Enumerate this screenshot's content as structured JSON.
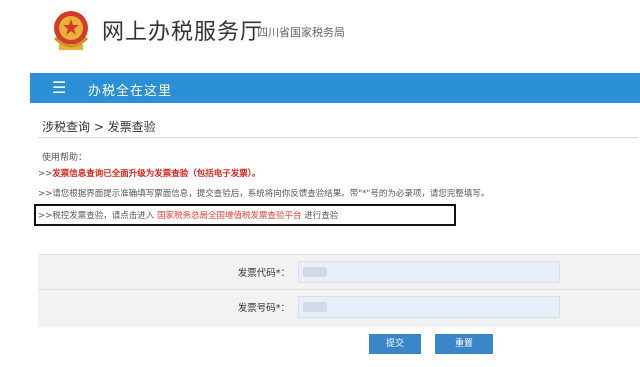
{
  "header": {
    "emblem_icon": "national-emblem-icon",
    "title": "网上办税服务厅",
    "subtitle": "四川省国家税务局"
  },
  "navbar": {
    "menu_icon": "☰",
    "label": "办税全在这里",
    "color": "#2a8fd5"
  },
  "breadcrumb": "涉税查询 > 发票查验",
  "help": {
    "title": "使用帮助：",
    "line1": {
      "prefix": ">>",
      "text": "发票信息查询已全面升级为发票查验（包括电子发票）。"
    },
    "line2": {
      "prefix": ">>",
      "text": "请您根据界面提示准确填写票面信息，提交查验后，系统将向你反馈查验结果。带\"*\"号的为必录项，请您完整填写。"
    },
    "line3": {
      "prefix": ">>",
      "before": "税控发票查验，请点击进入",
      "link": "国家税务总局全国增值税发票查验平台",
      "after": "进行查验"
    }
  },
  "form": {
    "invoice_code_label": "发票代码*：",
    "invoice_number_label": "发票号码*："
  },
  "buttons": {
    "submit": "提交",
    "reset": "重置"
  }
}
